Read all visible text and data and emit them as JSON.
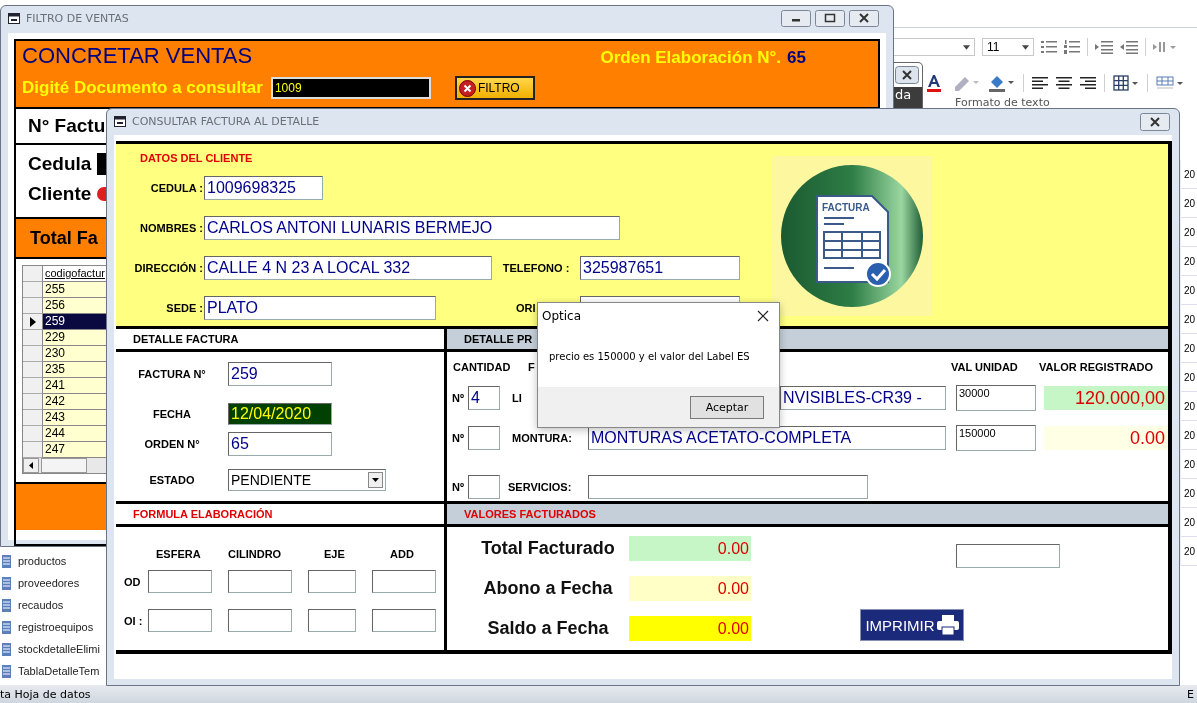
{
  "background_app": {
    "ribbon": {
      "tab_fragment": "da",
      "font_size": "11",
      "group_label": "Formato de texto"
    },
    "column_cells": [
      "20",
      "20",
      "20",
      "20",
      "20",
      "20",
      "20",
      "20",
      "20",
      "20",
      "20",
      "20",
      "20",
      "20"
    ],
    "nav_items": [
      "productos",
      "proveedores",
      "recaudos",
      "registroequipos",
      "stockdetalleElimi",
      "TablaDetalleTem"
    ],
    "status_bar": {
      "text": "ta Hoja de datos",
      "right": "E"
    }
  },
  "filter_window": {
    "title": "FILTRO DE VENTAS",
    "heading": "CONCRETAR VENTAS",
    "order_label": "Orden Elaboración N°.",
    "order_number": "65",
    "document_label": "Digité Documento a consultar",
    "document_value": "1009",
    "filter_button": "FILTRO",
    "invoice_label": "N° Factu",
    "id_label": "Cedula",
    "client_label": "Cliente",
    "total_label": "Total Fa",
    "grid": {
      "column": "codigofactur",
      "rows": [
        {
          "value": "255",
          "selected": false
        },
        {
          "value": "256",
          "selected": false
        },
        {
          "value": "259",
          "selected": true
        },
        {
          "value": "229",
          "selected": false
        },
        {
          "value": "230",
          "selected": false
        },
        {
          "value": "235",
          "selected": false
        },
        {
          "value": "241",
          "selected": false
        },
        {
          "value": "242",
          "selected": false
        },
        {
          "value": "243",
          "selected": false
        },
        {
          "value": "244",
          "selected": false
        },
        {
          "value": "247",
          "selected": false
        }
      ]
    }
  },
  "detail_window": {
    "title": "CONSULTAR FACTURA AL DETALLE",
    "client": {
      "heading": "DATOS DEL CLIENTE",
      "cedula": {
        "label": "CEDULA :",
        "value": "1009698325"
      },
      "names": {
        "label": "NOMBRES :",
        "value": "CARLOS ANTONI LUNARIS BERMEJO"
      },
      "address": {
        "label": "DIRECCIÓN :",
        "value": "CALLE 4 N 23 A LOCAL 332"
      },
      "phone": {
        "label": "TELEFONO :",
        "value": "325987651"
      },
      "branch": {
        "label": "SEDE :",
        "value": "PLATO"
      },
      "origin": {
        "label": "ORI"
      },
      "logo_text": "FACTURA"
    },
    "invoice": {
      "heading": "DETALLE FACTURA",
      "number": {
        "label": "FACTURA  N°",
        "value": "259"
      },
      "date": {
        "label": "FECHA",
        "value": "12/04/2020"
      },
      "order": {
        "label": "ORDEN N°",
        "value": "65"
      },
      "status": {
        "label": "ESTADO",
        "value": "PENDIENTE"
      }
    },
    "products": {
      "heading": "DETALLE PR",
      "columns": [
        "CANTIDAD",
        "F",
        "VAL UNIDAD",
        "VALOR REGISTRADO"
      ],
      "rows": [
        {
          "kind": "lens",
          "number_label": "Nº",
          "quantity": "4",
          "label": "LI",
          "description": "NVISIBLES-CR39  -",
          "unit_price": "30000",
          "total": "120.000,00",
          "color": "#c6f5c6"
        },
        {
          "kind": "frame",
          "number_label": "Nº",
          "label": "MONTURA:",
          "description": "MONTURAS  ACETATO-COMPLETA",
          "unit_price": "150000",
          "total": "0.00",
          "color": "#ffffe6"
        },
        {
          "kind": "service",
          "number_label": "Nº",
          "label": "SERVICIOS:"
        }
      ]
    },
    "formula": {
      "heading": "FORMULA ELABORACIÓN",
      "columns": [
        "ESFERA",
        "CILINDRO",
        "EJE",
        "ADD"
      ],
      "rows": [
        {
          "label": "OD"
        },
        {
          "label": "OI :"
        }
      ]
    },
    "totals": {
      "heading": "VALORES FACTURADOS",
      "items": [
        {
          "label": "Total Facturado",
          "value": "0.00",
          "color": "#c6f5c6"
        },
        {
          "label": "Abono a Fecha",
          "value": "0.00",
          "color": "#ffffc6"
        },
        {
          "label": "Saldo a Fecha",
          "value": "0.00",
          "color": "#ffff00"
        }
      ],
      "print_button": "IMPRIMIR"
    }
  },
  "message_box": {
    "title": "Optica",
    "message": "precio es 150000 y el valor del Label ES",
    "button": "Aceptar"
  }
}
